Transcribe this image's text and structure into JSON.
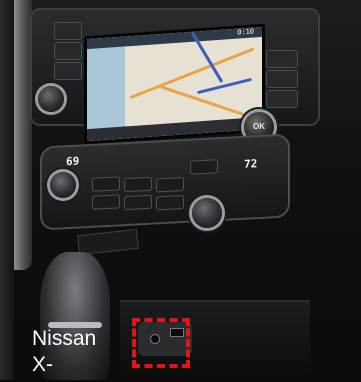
{
  "caption": {
    "line1": "Nissan",
    "line2": "X-"
  },
  "head_unit": {
    "status_time": "0:10",
    "knob_right_label": "OK"
  },
  "climate": {
    "left_temp": "69",
    "right_temp": "72"
  },
  "highlight": {
    "color": "#e2141b",
    "style": "dashed",
    "target": "usb-aux-port"
  }
}
